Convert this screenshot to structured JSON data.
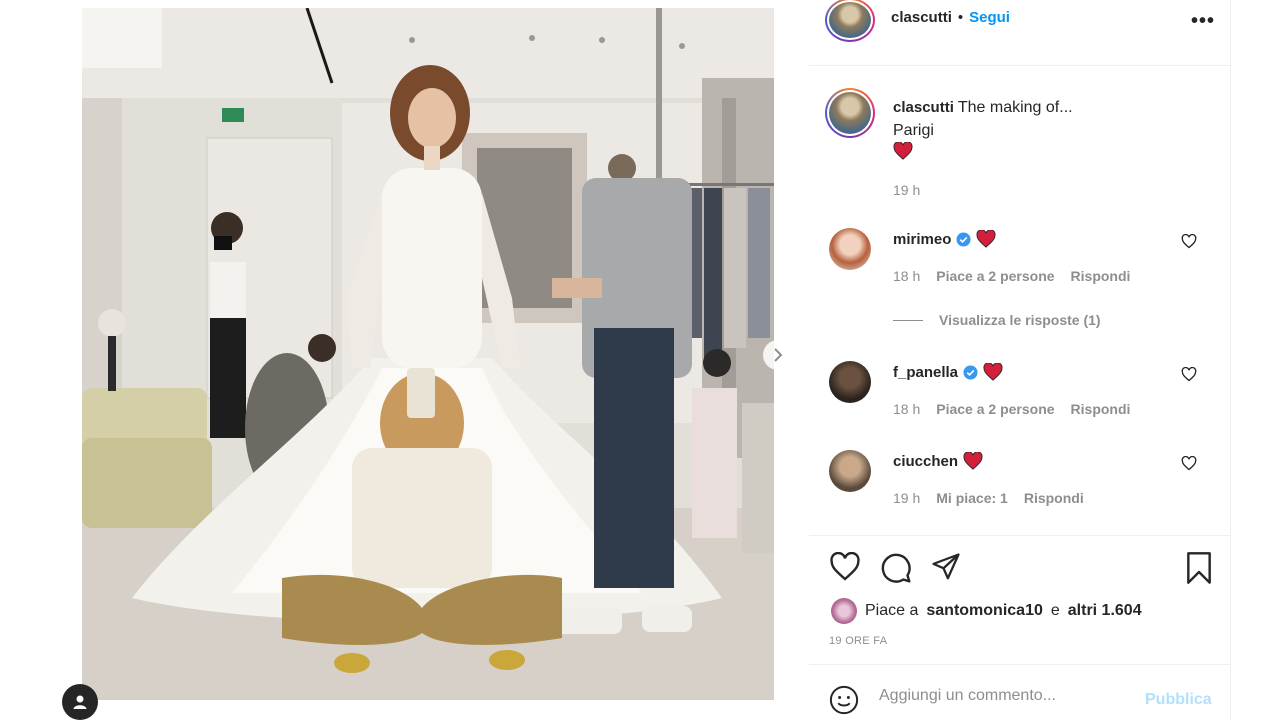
{
  "post": {
    "username": "clascutti",
    "follow_label": "Segui",
    "separator": "•",
    "more_label": "•••"
  },
  "caption": {
    "username": "clascutti",
    "text": "The making of...",
    "line2": "Parigi",
    "emoji": "heart",
    "time": "19 h"
  },
  "comments": [
    {
      "username": "mirimeo",
      "verified": true,
      "emoji": "heart",
      "time": "18 h",
      "likes": "Piace a 2 persone",
      "reply": "Rispondi"
    },
    {
      "username": "f_panella",
      "verified": true,
      "emoji": "heart",
      "time": "18 h",
      "likes": "Piace a 2 persone",
      "reply": "Rispondi"
    },
    {
      "username": "ciucchen",
      "verified": false,
      "emoji": "heart",
      "time": "19 h",
      "likes": "Mi piace: 1",
      "reply": "Rispondi"
    }
  ],
  "view_replies": "Visualizza le risposte (1)",
  "likes": {
    "prefix": "Piace a",
    "user": "santomonica10",
    "middle": "e",
    "others": "altri 1.604"
  },
  "ago": "19 ORE FA",
  "composer": {
    "placeholder": "Aggiungi un commento...",
    "publish": "Pubblica"
  },
  "icons": [
    "heart-icon",
    "comment-icon",
    "share-icon",
    "bookmark-icon",
    "emoji-icon",
    "chevron-right-icon",
    "user-tag-icon",
    "verified-icon"
  ],
  "colors": {
    "accent": "#0095f6",
    "publish_disabled": "#b2dffc",
    "heart": "#ed4956",
    "muted": "#8e8e8e",
    "border": "#efefef"
  }
}
